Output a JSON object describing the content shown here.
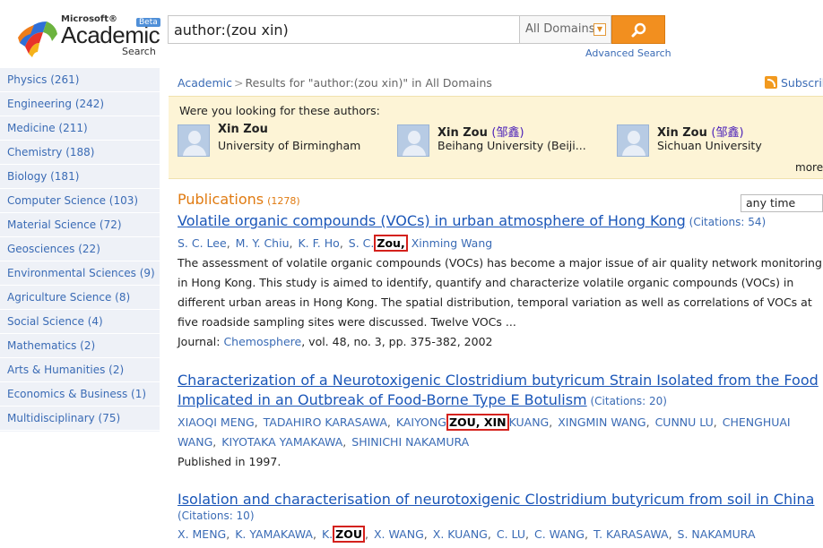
{
  "header": {
    "logo_microsoft": "Microsoft®",
    "logo_academic": "Academic",
    "logo_search": "Search",
    "logo_beta": "Beta",
    "search_value": "author:(zou xin)",
    "domain_selected": "All Domains",
    "advanced_search": "Advanced Search",
    "search_icon": "magnifier-icon",
    "colors": {
      "accent": "#f28f1f",
      "link": "#3a6bb5",
      "title_link": "#1a56b8",
      "heading": "#e07b12",
      "suggest_bg": "#fdf4d6",
      "sidebar_bg": "#eef1f7"
    }
  },
  "sidebar": {
    "items": [
      {
        "label": "Physics (261)"
      },
      {
        "label": "Engineering (242)"
      },
      {
        "label": "Medicine (211)"
      },
      {
        "label": "Chemistry (188)"
      },
      {
        "label": "Biology (181)"
      },
      {
        "label": "Computer Science (103)"
      },
      {
        "label": "Material Science (72)"
      },
      {
        "label": "Geosciences (22)"
      },
      {
        "label": "Environmental Sciences (9)"
      },
      {
        "label": "Agriculture Science (8)"
      },
      {
        "label": "Social Science (4)"
      },
      {
        "label": "Mathematics (2)"
      },
      {
        "label": "Arts & Humanities (2)"
      },
      {
        "label": "Economics & Business (1)"
      },
      {
        "label": "Multidisciplinary (75)"
      }
    ]
  },
  "breadcrumb": {
    "root": "Academic",
    "separator": ">",
    "text": "Results for \"author:(zou xin)\" in All Domains"
  },
  "subscribe": {
    "label": "Subscrib",
    "icon": "rss-icon"
  },
  "suggest": {
    "prompt": "Were you looking for these authors:",
    "more": "more",
    "authors": [
      {
        "name": "Xin Zou",
        "cn": "",
        "affiliation": "University of Birmingham"
      },
      {
        "name": "Xin Zou",
        "cn": "(邹鑫)",
        "affiliation": "Beihang University (Beiji..."
      },
      {
        "name": "Xin Zou",
        "cn": "(邹鑫)",
        "affiliation": "Sichuan University"
      }
    ]
  },
  "publications": {
    "heading": "Publications",
    "count": "(1278)",
    "time_filter": "any time",
    "items": [
      {
        "title": "Volatile organic compounds (VOCs) in urban atmosphere of Hong Kong",
        "citations": "(Citations: 54)",
        "authors": [
          "S. C. Lee",
          "M. Y. Chiu",
          "K. F. Ho",
          "S. C."
        ],
        "highlight": "Zou",
        "authors_after": [
          "Xinming Wang"
        ],
        "abstract": "The assessment of volatile organic compounds (VOCs) has become a major issue of air quality network monitoring in Hong Kong. This study is aimed to identify, quantify and characterize volatile organic compounds (VOCs) in different urban areas in Hong Kong. The spatial distribution, temporal variation as well as correlations of VOCs at five roadside sampling sites were discussed. Twelve VOCs ...",
        "journal_label": "Journal:",
        "journal": "Chemosphere",
        "journal_details": ", vol. 48, no. 3, pp. 375-382, 2002"
      },
      {
        "title_line1": "Characterization of a Neurotoxigenic Clostridium butyricum Strain Isolated from the Food",
        "title_line2": "Implicated in an Outbreak of Food-Borne Type E Botulism",
        "citations": "(Citations: 20)",
        "authors_line1": [
          "XIAOQI MENG",
          "TADAHIRO KARASAWA"
        ],
        "author_before_hl": "KAIYONG",
        "highlight": "ZOU,  XIN",
        "author_after_hl": "KUANG",
        "authors_line1_after": [
          "XINGMIN WANG",
          "CUNNU LU",
          "CHENGHUAI"
        ],
        "authors_line2": [
          "WANG",
          "KIYOTAKA YAMAKAWA",
          "SHINICHI NAKAMURA"
        ],
        "published": "Published in 1997."
      },
      {
        "title": "Isolation and characterisation of neurotoxigenic Clostridium butyricum from soil in China",
        "citations": "(Citations: 10)",
        "authors_before": [
          "X. MENG",
          "K. YAMAKAWA"
        ],
        "author_before_hl": "K.",
        "highlight": "ZOU",
        "authors_after": [
          "X. WANG",
          "X. KUANG",
          "C. LU",
          "C. WANG",
          "T. KARASAWA",
          "S. NAKAMURA"
        ]
      }
    ]
  }
}
